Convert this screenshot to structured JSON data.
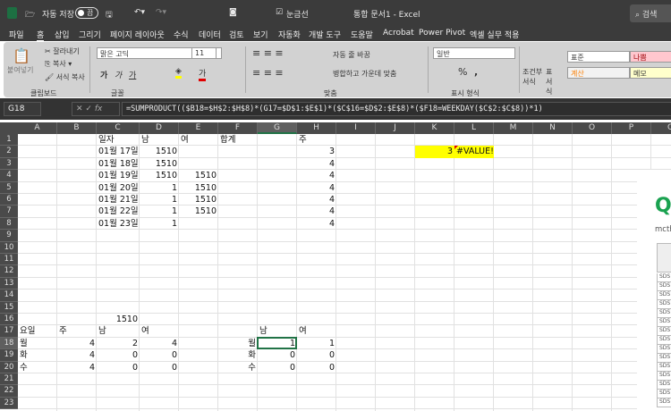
{
  "titlebar": {
    "autosave": "자동 저장",
    "toggle": "끔",
    "gridlines": "눈금선",
    "title": "통합 문서1 - Excel",
    "search": "검색"
  },
  "tabs": [
    "파일",
    "홈",
    "삽입",
    "그리기",
    "페이지 레이아웃",
    "수식",
    "데이터",
    "검토",
    "보기",
    "자동화",
    "개발 도구",
    "도움말",
    "Acrobat",
    "Power Pivot",
    "엑셀 실무 적용"
  ],
  "ribbon": {
    "clipboard": {
      "paste": "붙여넣기",
      "cut": "잘라내기",
      "copy": "복사",
      "format_painter": "서식 복사",
      "label": "클립보드"
    },
    "font": {
      "name": "맑은 고딕",
      "size": "11",
      "bold": "가",
      "italic": "가",
      "underline": "가",
      "label": "글꼴"
    },
    "align": {
      "wrap": "자동 줄 바꿈",
      "merge": "병합하고 가운데 맞춤",
      "label": "맞춤"
    },
    "number": {
      "format": "일반",
      "percent": "%",
      "comma": ",",
      "label": "표시 형식"
    },
    "styles": {
      "conditional": "조건부 서식",
      "table": "표 서식",
      "normal": "표준",
      "bad": "나쁨",
      "calc": "계산",
      "memo": "메모"
    }
  },
  "formula_bar": {
    "name_box": "G18",
    "fx": "fx",
    "formula": "=SUMPRODUCT(($B18=$H$2:$H$8)*(G17=$D$1:$E$1)*($C$16=$D$2:$E$8)*($F18=WEEKDAY($C$2:$C$8))*1)"
  },
  "columns": [
    "A",
    "B",
    "C",
    "D",
    "E",
    "F",
    "G",
    "H",
    "I",
    "J",
    "K",
    "L",
    "M",
    "N",
    "O",
    "P",
    "Q"
  ],
  "selected_cell": "G18",
  "cells": {
    "C1": "일자",
    "D1": "남",
    "E1": "여",
    "F1": "합계",
    "H1": "주",
    "C2": "01월 17일",
    "D2": "1510",
    "H2": "3",
    "C3": "01월 18일",
    "D3": "1510",
    "H3": "4",
    "C4": "01월 19일",
    "D4": "1510",
    "E4": "1510",
    "H4": "4",
    "C5": "01월 20일",
    "D5": "1",
    "E5": "1510",
    "H5": "4",
    "C6": "01월 21일",
    "D6": "1",
    "E6": "1510",
    "H6": "4",
    "C7": "01월 22일",
    "D7": "1",
    "E7": "1510",
    "H7": "4",
    "C8": "01월 23일",
    "D8": "1",
    "H8": "4",
    "K2": "3",
    "L2": "#VALUE!",
    "C16": "1510",
    "A17": "요일",
    "B17": "주",
    "C17": "남",
    "D17": "여",
    "G17": "남",
    "H17": "여",
    "A18": "월",
    "B18": "4",
    "C18": "2",
    "D18": "4",
    "F18": "월",
    "G18": "1",
    "H18": "1",
    "A19": "화",
    "B19": "4",
    "C19": "0",
    "D19": "0",
    "F19": "화",
    "G19": "0",
    "H19": "0",
    "A20": "수",
    "B20": "4",
    "C20": "0",
    "D20": "0",
    "F20": "수",
    "G20": "0",
    "H20": "0"
  },
  "overlay": {
    "logo": "Q",
    "text": "mcth",
    "row_label": "SDS"
  },
  "colors": {
    "highlight": "#ffff00",
    "selection": "#217346",
    "error_marker": "#e00000"
  }
}
